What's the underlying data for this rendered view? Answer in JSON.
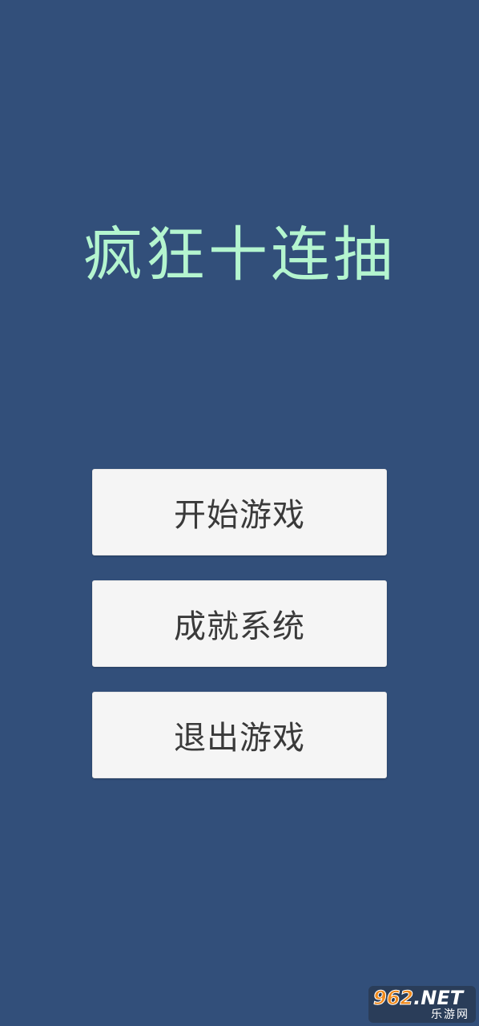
{
  "title": "疯狂十连抽",
  "menu": {
    "start": "开始游戏",
    "achievements": "成就系统",
    "exit": "退出游戏"
  },
  "watermark": {
    "number": "962",
    "domain": ".NET",
    "subtitle": "乐游网"
  },
  "colors": {
    "background": "#324f7a",
    "title": "#b4f5cf",
    "button": "#f5f5f5",
    "button_text": "#3a3a3a"
  }
}
